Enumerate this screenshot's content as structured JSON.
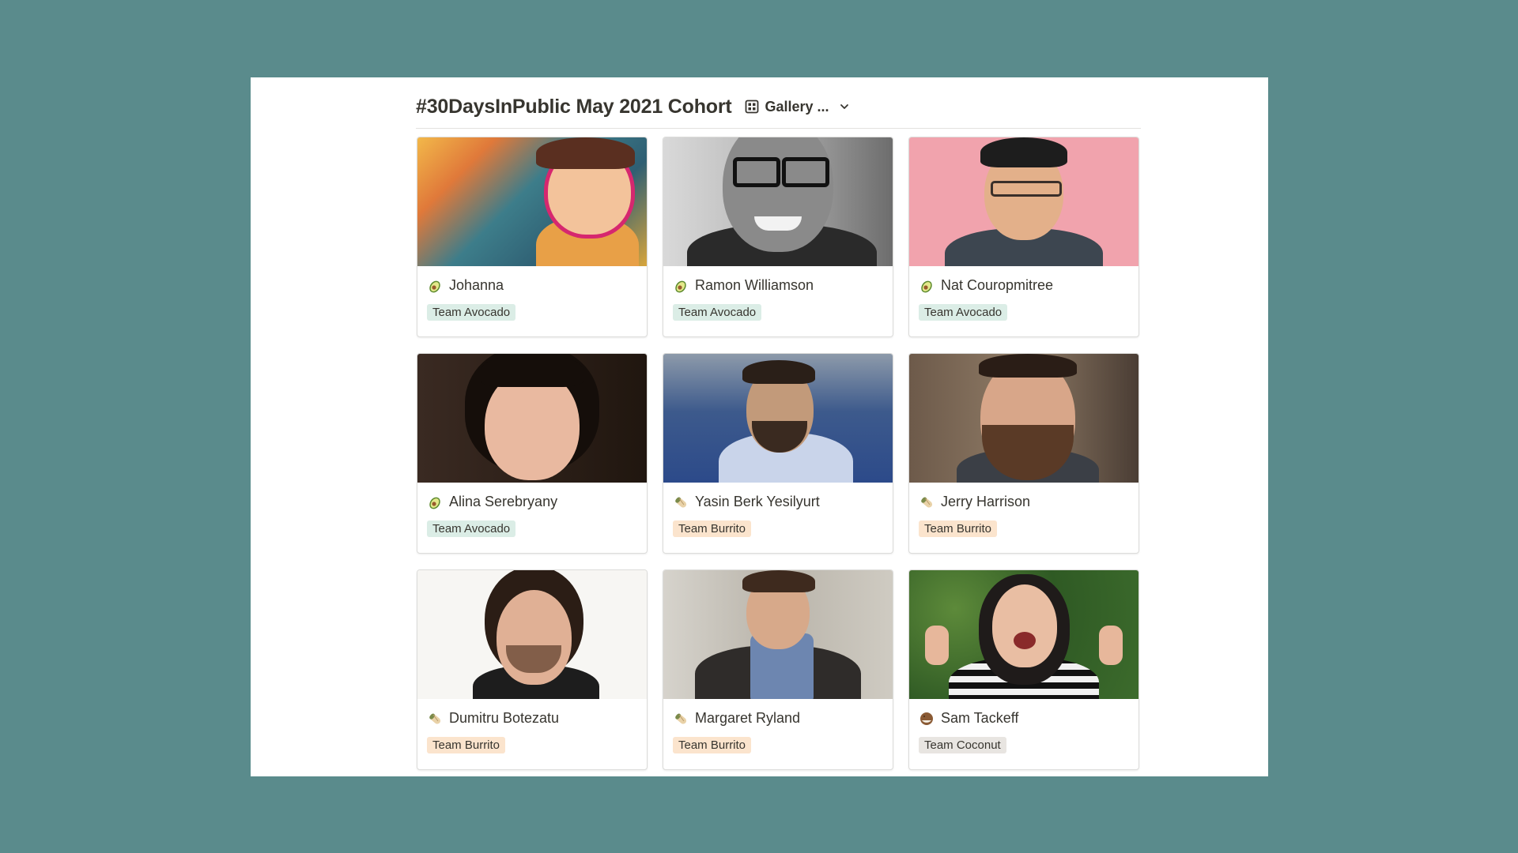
{
  "header": {
    "title": "#30DaysInPublic May 2021 Cohort",
    "view_label": "Gallery ..."
  },
  "cards": [
    {
      "name": "Johanna",
      "team": "Team Avocado",
      "emoji": "avocado-icon"
    },
    {
      "name": "Ramon Williamson",
      "team": "Team Avocado",
      "emoji": "avocado-icon"
    },
    {
      "name": "Nat Couropmitree",
      "team": "Team Avocado",
      "emoji": "avocado-icon"
    },
    {
      "name": "Alina Serebryany",
      "team": "Team Avocado",
      "emoji": "avocado-icon"
    },
    {
      "name": "Yasin Berk Yesilyurt",
      "team": "Team Burrito",
      "emoji": "burrito-icon"
    },
    {
      "name": "Jerry Harrison",
      "team": "Team Burrito",
      "emoji": "burrito-icon"
    },
    {
      "name": "Dumitru Botezatu",
      "team": "Team Burrito",
      "emoji": "burrito-icon"
    },
    {
      "name": "Margaret Ryland",
      "team": "Team Burrito",
      "emoji": "burrito-icon"
    },
    {
      "name": "Sam Tackeff",
      "team": "Team Coconut",
      "emoji": "coconut-icon"
    }
  ],
  "colors": {
    "background": "#5a8b8c",
    "tag_avocado": "#dbede6",
    "tag_burrito": "#fbe4cd",
    "tag_coconut": "#e8e5e1"
  }
}
